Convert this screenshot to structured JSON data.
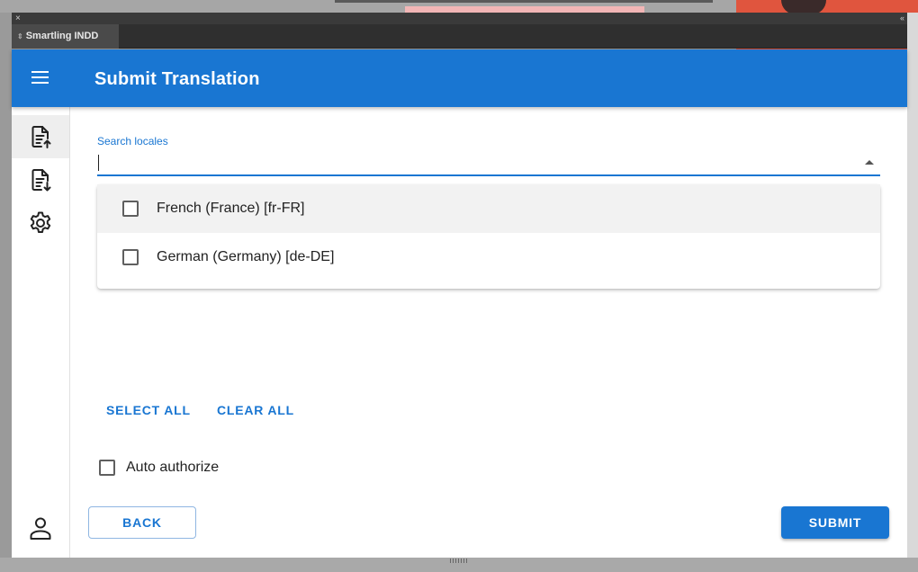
{
  "window": {
    "close_glyph": "×",
    "collapse_glyph": "‹‹",
    "tab_grip_glyph": "⇕",
    "tab_label": "Smartling INDD"
  },
  "appbar": {
    "title": "Submit Translation",
    "menu_icon": "hamburger-menu-icon",
    "color": "#1976d2"
  },
  "sidebar": {
    "items": [
      {
        "icon": "file-upload-icon",
        "active": true
      },
      {
        "icon": "file-download-icon",
        "active": false
      },
      {
        "icon": "gear-icon",
        "active": false
      }
    ],
    "user_icon": "user-icon"
  },
  "search": {
    "label": "Search locales",
    "value": "",
    "placeholder": ""
  },
  "locales": {
    "options": [
      {
        "label": "French (France) [fr-FR]",
        "checked": false
      },
      {
        "label": "German (Germany) [de-DE]",
        "checked": false
      }
    ]
  },
  "actions": {
    "select_all": "SELECT ALL",
    "clear_all": "CLEAR ALL"
  },
  "auto_authorize": {
    "label": "Auto authorize",
    "checked": false
  },
  "footer": {
    "back": "BACK",
    "submit": "SUBMIT"
  }
}
